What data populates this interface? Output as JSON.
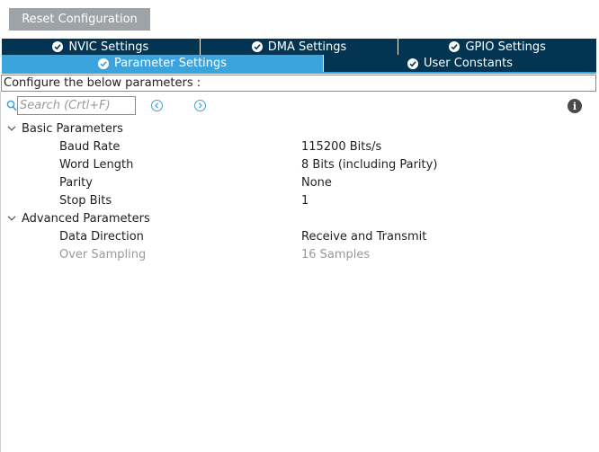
{
  "toolbar": {
    "reset_label": "Reset Configuration"
  },
  "tabs_row1": [
    {
      "label": "NVIC Settings",
      "icon": "check-circle-icon"
    },
    {
      "label": "DMA Settings",
      "icon": "check-circle-icon"
    },
    {
      "label": "GPIO Settings",
      "icon": "check-circle-icon"
    }
  ],
  "tabs_row2": [
    {
      "label": "Parameter Settings",
      "icon": "check-circle-icon",
      "active": true
    },
    {
      "label": "User Constants",
      "icon": "check-circle-icon"
    }
  ],
  "configure_label": "Configure the below parameters :",
  "search": {
    "placeholder": "Search (Crtl+F)",
    "value": ""
  },
  "groups": [
    {
      "label": "Basic Parameters",
      "expanded": true,
      "params": [
        {
          "name": "Baud Rate",
          "value": "115200 Bits/s"
        },
        {
          "name": "Word Length",
          "value": "8 Bits (including Parity)"
        },
        {
          "name": "Parity",
          "value": "None"
        },
        {
          "name": "Stop Bits",
          "value": "1"
        }
      ]
    },
    {
      "label": "Advanced Parameters",
      "expanded": true,
      "params": [
        {
          "name": "Data Direction",
          "value": "Receive and Transmit"
        },
        {
          "name": "Over Sampling",
          "value": "16 Samples",
          "disabled": true
        }
      ]
    }
  ],
  "colors": {
    "tab_dark": "#033553",
    "tab_active": "#3ba4dc",
    "button_gray": "#9ea3a7",
    "disabled_text": "#9a9a9a"
  }
}
